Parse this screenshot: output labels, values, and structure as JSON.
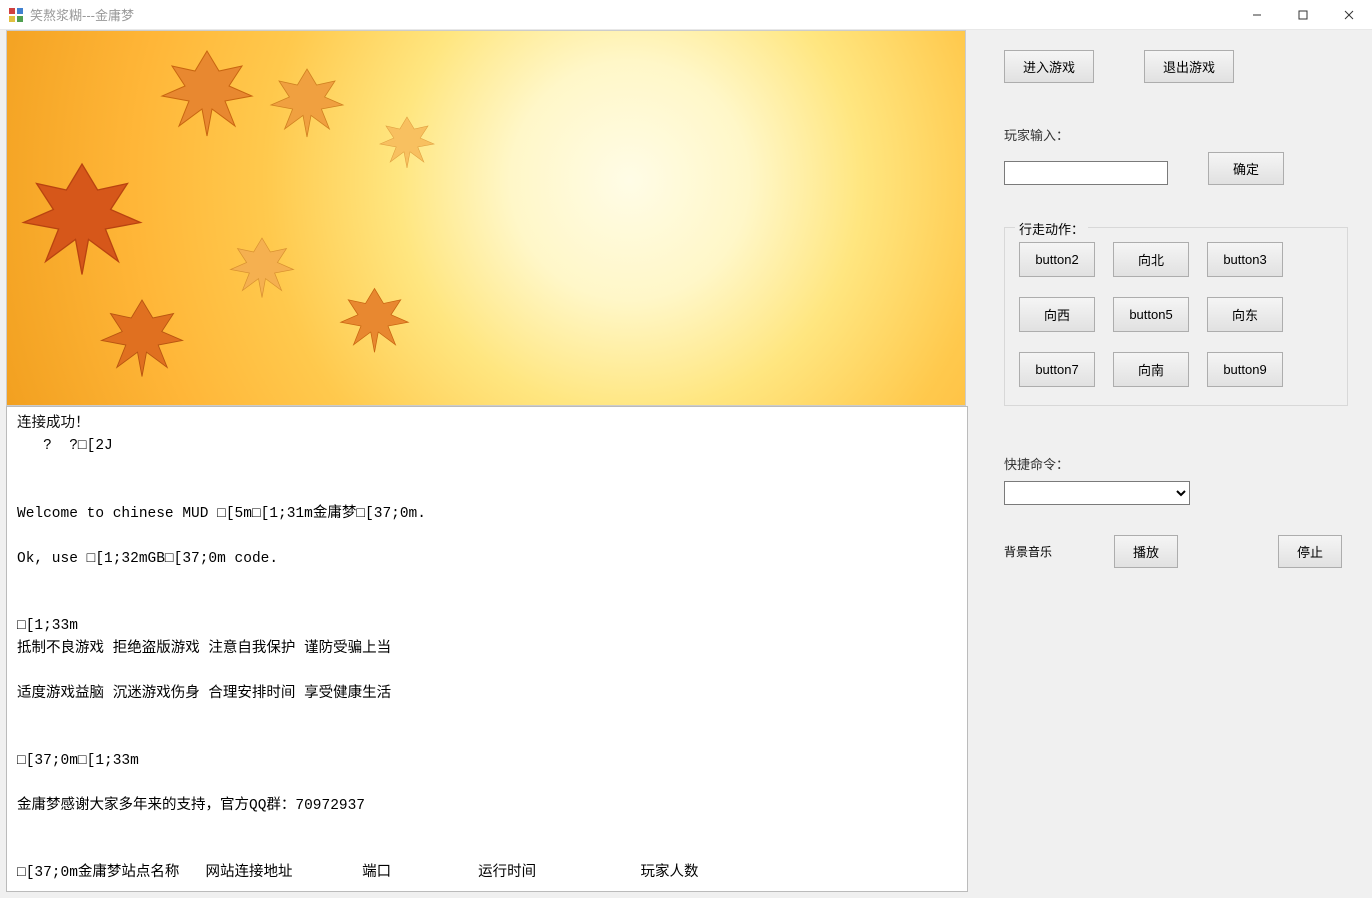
{
  "window": {
    "title": "笑熬浆糊---金庸梦"
  },
  "top": {
    "enter": "进入游戏",
    "exit": "退出游戏"
  },
  "input": {
    "label": "玩家输入：",
    "value": "",
    "confirm": "确定"
  },
  "move": {
    "title": "行走动作：",
    "b1": "button2",
    "b2": "向北",
    "b3": "button3",
    "b4": "向西",
    "b5": "button5",
    "b6": "向东",
    "b7": "button7",
    "b8": "向南",
    "b9": "button9"
  },
  "quick": {
    "label": "快捷命令：",
    "selected": ""
  },
  "music": {
    "label": "背景音乐",
    "play": "播放",
    "stop": "停止"
  },
  "console": {
    "l0": "连接成功！",
    "l1": "   ?  ?□[2J",
    "l2": "",
    "l3": "",
    "l4": "Welcome to chinese MUD □[5m□[1;31m金庸梦□[37;0m.",
    "l5": "",
    "l6": "Ok, use □[1;32mGB□[37;0m code.",
    "l7": "",
    "l8": "",
    "l9": "□[1;33m",
    "l10": "抵制不良游戏 拒绝盗版游戏 注意自我保护 谨防受骗上当",
    "l11": "",
    "l12": "适度游戏益脑 沉迷游戏伤身 合理安排时间 享受健康生活",
    "l13": "",
    "l14": "",
    "l15": "□[37;0m□[1;33m",
    "l16": "",
    "l17": "金庸梦感谢大家多年来的支持，官方QQ群：70972937",
    "l18": "",
    "l19": "",
    "l20": "□[37;0m金庸梦站点名称   网站连接地址        端口          运行时间            玩家人数"
  }
}
